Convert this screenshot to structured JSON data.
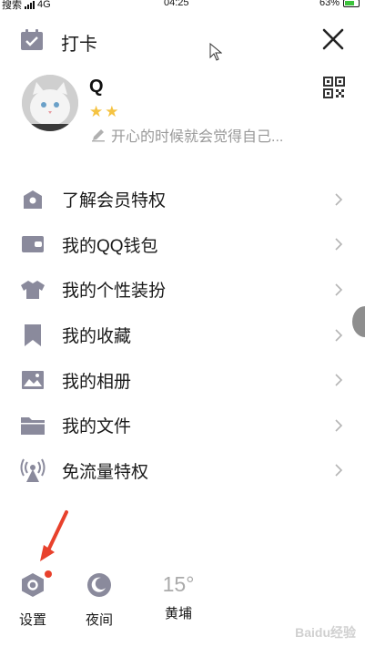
{
  "status_bar": {
    "carrier": "搜索",
    "network": "4G",
    "time": "04:25",
    "battery": "63%"
  },
  "header": {
    "checkin_label": "打卡"
  },
  "profile": {
    "username": "Q",
    "level_stars": 2,
    "signature": "开心的时候就会觉得自己..."
  },
  "menu": {
    "items": [
      {
        "label": "了解会员特权",
        "icon": "crown-icon"
      },
      {
        "label": "我的QQ钱包",
        "icon": "wallet-icon"
      },
      {
        "label": "我的个性装扮",
        "icon": "shirt-icon"
      },
      {
        "label": "我的收藏",
        "icon": "bookmark-icon"
      },
      {
        "label": "我的相册",
        "icon": "photo-icon"
      },
      {
        "label": "我的文件",
        "icon": "folder-icon"
      },
      {
        "label": "免流量特权",
        "icon": "antenna-icon"
      }
    ]
  },
  "bottom": {
    "settings_label": "设置",
    "night_label": "夜间",
    "temperature": "15°",
    "location": "黄埔"
  },
  "watermark": "Baidu经验",
  "colors": {
    "icon": "#8a8a9c",
    "accent_red": "#e8412c",
    "star": "#f5c342"
  }
}
